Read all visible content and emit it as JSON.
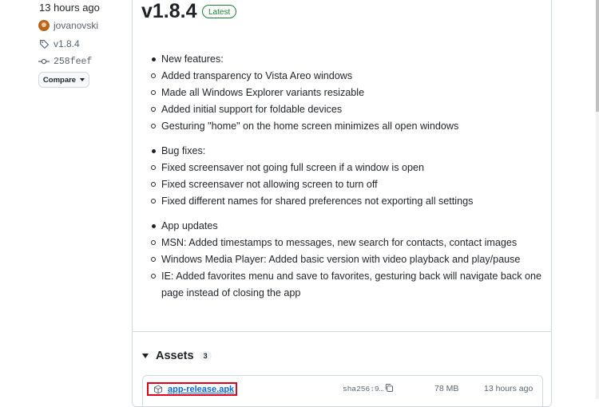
{
  "sidebar": {
    "time": "13 hours ago",
    "author": "jovanovski",
    "tag": "v1.8.4",
    "commit": "258feef",
    "compare_label": "Compare"
  },
  "release": {
    "title": "v1.8.4",
    "badge": "Latest",
    "sections": [
      {
        "heading": "New features:",
        "items": [
          "Added transparency to Vista Areo windows",
          "Made all Windows Explorer variants resizable",
          "Added initial support for foldable devices",
          "Gesturing \"home\" on the home screen minimizes all open windows"
        ]
      },
      {
        "heading": "Bug fixes:",
        "items": [
          "Fixed screensaver not going full screen if a window is open",
          "Fixed screensaver not allowing screen to turn off",
          "Fixed different names for shared preferences not exporting all settings"
        ]
      },
      {
        "heading": "App updates",
        "items": [
          "MSN: Added timestamps to messages, new search for contacts, contact images",
          "Windows Media Player: Added basic version with video playback and play/pause",
          "IE: Added favorites menu and save to favorites, gesturing back will navigate back one page instead of closing the app"
        ]
      }
    ]
  },
  "assets": {
    "heading": "Assets",
    "count": "3",
    "rows": [
      {
        "name": "app-release.apk",
        "sha": "sha256:9…",
        "size": "78 MB",
        "time": "13 hours ago"
      }
    ]
  },
  "colors": {
    "link": "#0969da",
    "latest_green": "#1a7f37",
    "highlight_red": "#e0001b"
  }
}
